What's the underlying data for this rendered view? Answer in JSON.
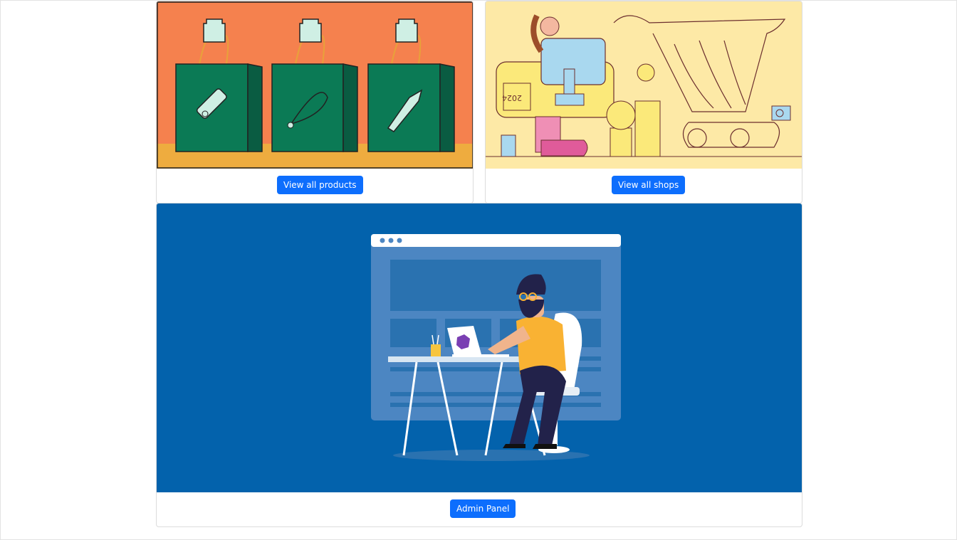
{
  "cards": {
    "products": {
      "button_label": "View all products"
    },
    "shops": {
      "button_label": "View all shops",
      "calendar_text": "2024"
    },
    "admin": {
      "button_label": "Admin Panel"
    }
  },
  "colors": {
    "primary_button": "#0d6efd",
    "products_bg": "#f5814e",
    "shops_bg": "#fde9a6",
    "admin_bg": "#0362ac"
  }
}
